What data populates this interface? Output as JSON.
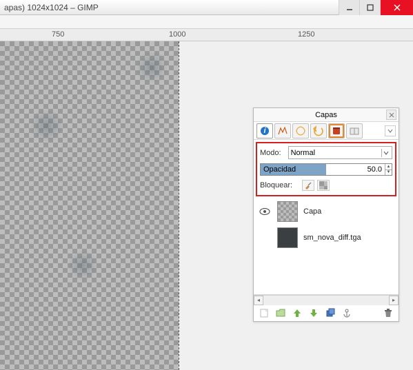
{
  "window": {
    "title": "apas) 1024x1024 – GIMP"
  },
  "ruler": {
    "ticks": [
      "750",
      "1000",
      "1250"
    ]
  },
  "panel": {
    "title": "Capas",
    "mode_label": "Modo:",
    "mode_value": "Normal",
    "opacity_label": "Opacidad",
    "opacity_value": "50.0",
    "opacity_percent": 50,
    "lock_label": "Bloquear:",
    "layers": [
      {
        "name": "Capa",
        "visible": true,
        "thumb": "checker"
      },
      {
        "name": "sm_nova_diff.tga",
        "visible": false,
        "thumb": "dark"
      }
    ]
  }
}
